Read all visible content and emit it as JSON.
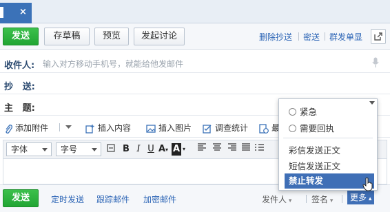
{
  "tab": {
    "close_label": "×"
  },
  "toolbar": {
    "send_label": "发送",
    "draft_label": "存草稿",
    "preview_label": "预览",
    "discuss_label": "发起讨论",
    "delete_cc_label": "删除抄送",
    "bcc_label": "密送",
    "group_send_label": "群发单显"
  },
  "fields": {
    "recipient_label": "收件人:",
    "recipient_placeholder": "输入对方移动手机号，就能给他发邮件",
    "cc_label": "抄   送:",
    "subject_label": "主   题:"
  },
  "attach_bar": {
    "add_attachment_label": "添加附件",
    "insert_content_label": "插入内容",
    "insert_image_label": "插入图片",
    "survey_label": "调查统计",
    "more_label": "最"
  },
  "format_bar": {
    "font_label": "字体",
    "size_label": "字号"
  },
  "bottom_bar": {
    "send_label": "发送",
    "scheduled_label": "定时发送",
    "track_label": "跟踪邮件",
    "encrypt_label": "加密邮件",
    "sender_label": "发件人",
    "signature_label": "签名",
    "more_label": "更多"
  },
  "dropdown": {
    "urgent_label": "紧急",
    "receipt_label": "需要回执",
    "mms_body_label": "彩信发送正文",
    "sms_body_label": "短信发送正文",
    "no_forward_label": "禁止转发"
  },
  "colors": {
    "accent_blue": "#3b72b8",
    "send_green": "#21a533",
    "link_blue": "#2b64b5",
    "menu_highlight": "#3f6fb6"
  }
}
